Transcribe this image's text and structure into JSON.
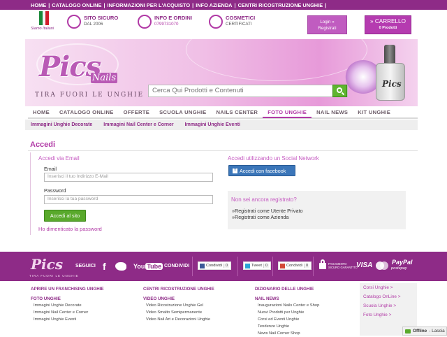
{
  "topbar": {
    "links": [
      "HOME",
      "CATALOGO ONLINE",
      "INFORMAZIONI PER L'ACQUISTO",
      "INFO AZIENDA",
      "CENTRI RICOSTRUZIONE UNGHIE"
    ],
    "sep": "|"
  },
  "header": {
    "siamo": "Siamo Italiani",
    "features": [
      {
        "title": "SITO SICURO",
        "sub": "DAL 2006"
      },
      {
        "title": "INFO E ORDINI",
        "sub": "0799731070"
      },
      {
        "title": "COSMETICI",
        "sub": "CERTIFICATI"
      }
    ],
    "login_line1": "Login »",
    "login_line2": "Registrati",
    "cart_line1": "CARRELLO",
    "cart_line2": "0 Prodotti",
    "cart_arrow": "»"
  },
  "banner": {
    "logo": "Pics",
    "logo_sub": "Nails",
    "tagline": "TIRA FUORI LE UNGHIE",
    "search_placeholder": "Cerca Qui Prodotti e Contenuti",
    "bottle_label": "Pics"
  },
  "nav": {
    "items": [
      "HOME",
      "CATALOGO ONLINE",
      "OFFERTE",
      "SCUOLA UNGHIE",
      "NAILS CENTER",
      "FOTO UNGHIE",
      "NAIL NEWS",
      "KIT UNGHIE"
    ],
    "active": "FOTO UNGHIE"
  },
  "subnav": [
    "Immagini Unghie Decorate",
    "Immagini Nail Center e Corner",
    "Immagini Unghie Eventi"
  ],
  "login": {
    "heading": "Accedi",
    "email_title": "Accedi via Email",
    "email_label": "Email",
    "email_placeholder": "Inserisci il tuo Indirizzo E-Mail",
    "password_label": "Password",
    "password_placeholder": "Inserisci la tua password",
    "submit": "Accedi al sito",
    "forgot": "Ho dimenticato la password",
    "social_title": "Accedi utilizzando un Social Network",
    "facebook": "Accedi con facebook",
    "facebook_icon": "f",
    "register_title": "Non sei ancora registrato?",
    "register_private": "»Registrati come Utente Privato",
    "register_company": "»Registrati come Azienda"
  },
  "footer_band": {
    "logo": "Pics",
    "logo_sub": "TIRA FUORI LE UNGHIE",
    "seguici": "SEGUICI",
    "facebook_glyph": "f",
    "youtube_1": "You",
    "youtube_2": "Tube",
    "condividi": "CONDIVIDI",
    "share_fb": "Condividi",
    "share_fb_count": "0",
    "share_tw": "Tweet",
    "share_tw_count": "0",
    "share_gp": "Condividi",
    "share_gp_count": "0",
    "pagamento": "PAGAMENTO",
    "sicuro": "SICURO GARANTITO",
    "visa": "VISA",
    "paypal": "PayPal",
    "postepay": "postepay"
  },
  "footer_links": {
    "col1": {
      "h1": "APRIRE UN FRANCHISING UNGHIE",
      "h2": "FOTO UNGHIE",
      "items": [
        "Immagini Unghie Decorate",
        "Immagini Nail Center e Corner",
        "Immagini Unghie Eventi"
      ]
    },
    "col2": {
      "h1": "CENTRI RICOSTRUZIONE UNGHIE",
      "h2": "VIDEO UNGHIE",
      "items": [
        "Video Ricostruzione Unghie Gel",
        "Video Smalto Semipermanente",
        "Video Nail Art e Decorazioni Unghie"
      ]
    },
    "col3": {
      "h1": "DIZIONARIO DELLE UNGHIE",
      "h2": "NAIL NEWS",
      "items": [
        "Inaugurazioni Nails Center e Shop",
        "Nuovi Prodotti per Unghie",
        "Corsi ed Eventi Unghie",
        "Tendenze Unghie",
        "News Nail Corner Shop"
      ]
    },
    "side": [
      "Corsi Unghie >",
      "Catalogo OnLine >",
      "Scuola Unghie >",
      "Foto Unghie >"
    ]
  },
  "chat": {
    "status": "Offline",
    "text": "- Lascia"
  }
}
